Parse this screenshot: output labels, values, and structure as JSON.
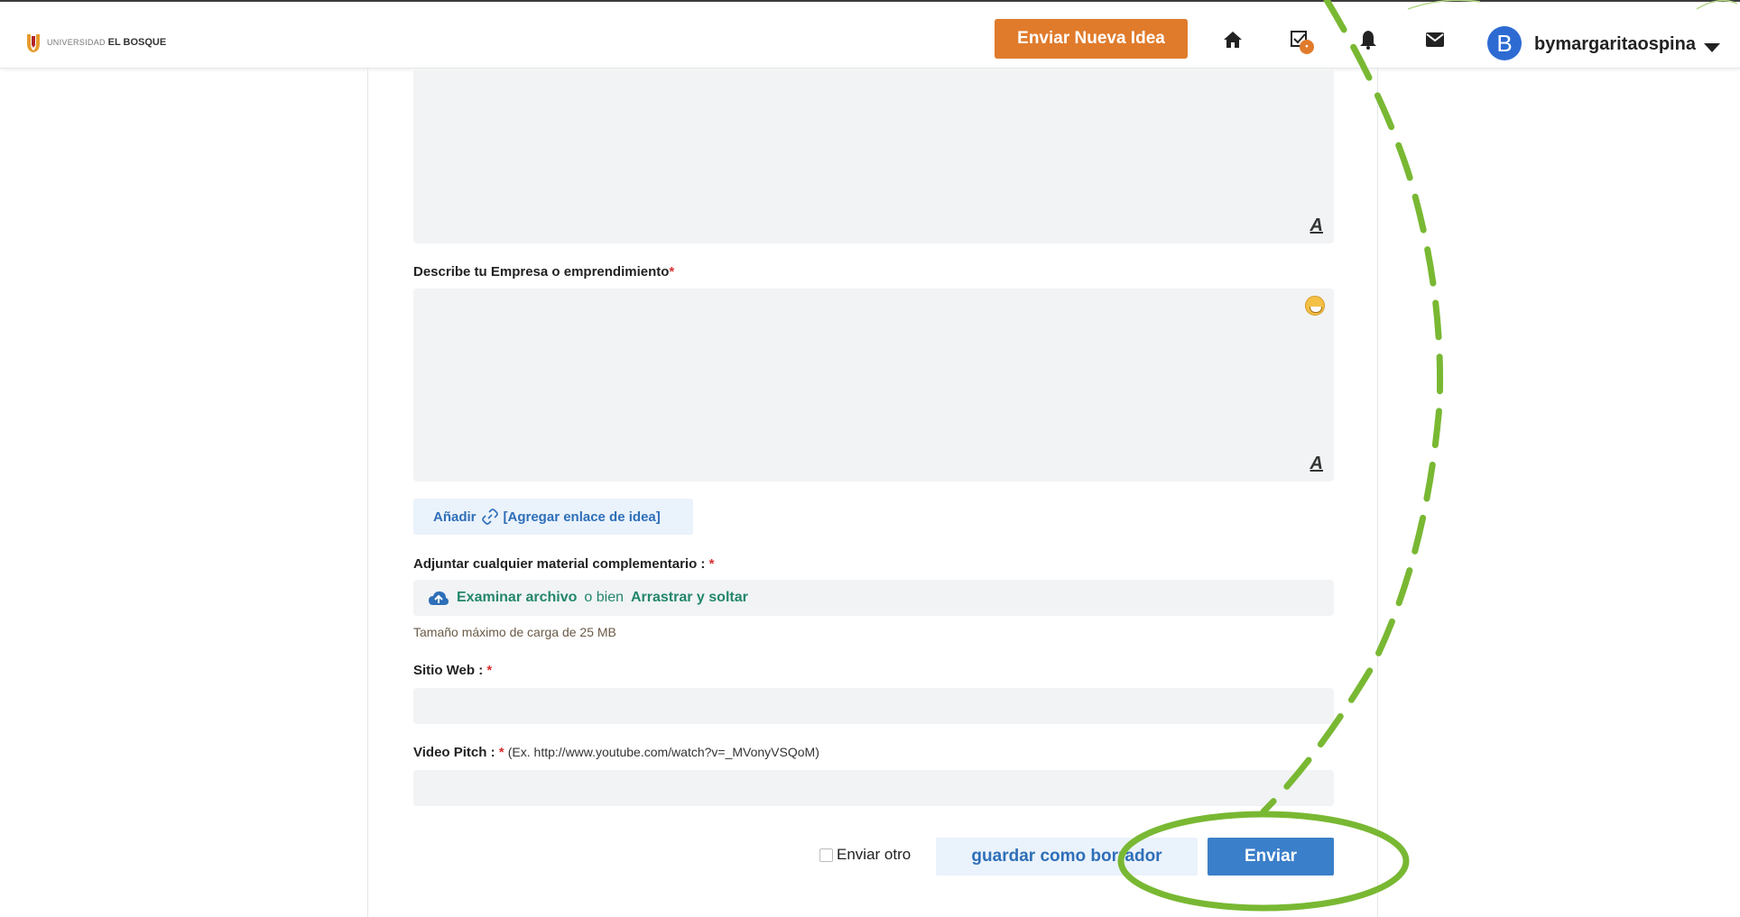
{
  "header": {
    "logo": {
      "small_text": "UNIVERSIDAD",
      "bold_text": "EL BOSQUE"
    },
    "new_idea_button": "Enviar Nueva Idea",
    "icons": [
      "home-icon",
      "tasks-icon",
      "bell-icon",
      "mail-icon"
    ],
    "tasks_badge": "•",
    "avatar_letter": "B",
    "username": "bymargaritaospina"
  },
  "form": {
    "business_label": "Describe tu Empresa o emprendimiento",
    "required_mark": "*",
    "add_link": {
      "prefix": "Añadir",
      "link_text": "[Agregar enlace de idea]"
    },
    "attachment_label": "Adjuntar cualquier material complementario :",
    "upload": {
      "browse": "Examinar archivo",
      "or": "o bien",
      "drag": "Arrastrar y soltar"
    },
    "max_size_note": "Tamaño máximo de carga de 25 MB",
    "website_label": "Sitio Web :",
    "video_label": "Video Pitch :",
    "video_hint": "(Ex. http://www.youtube.com/watch?v=_MVonyVSQoM)",
    "editor_icon": "A",
    "send_another": "Enviar otro",
    "save_draft": "guardar como borrador",
    "submit": "Enviar"
  },
  "colors": {
    "accent_orange": "#e07b2c",
    "primary_blue": "#3a7fc9",
    "link_blue": "#2e6fb8",
    "upload_green": "#23866b",
    "annotation_green": "#79b833"
  }
}
